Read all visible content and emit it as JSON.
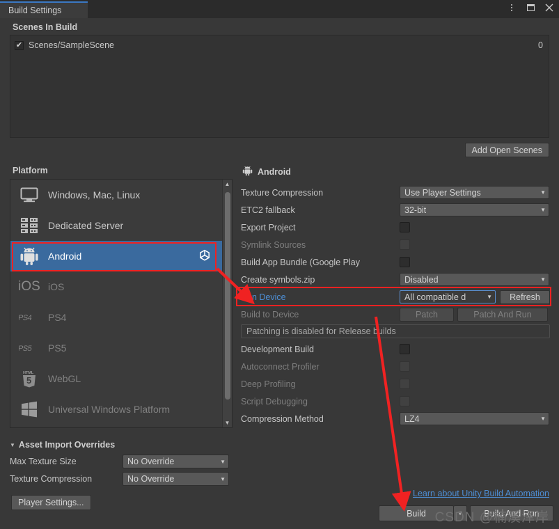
{
  "window": {
    "tab_label": "Build Settings",
    "controls": {
      "kebab": "kebab-menu-icon",
      "maximize": "maximize-icon",
      "close": "✕"
    }
  },
  "scenes": {
    "header": "Scenes In Build",
    "items": [
      {
        "name": "Scenes/SampleScene",
        "checked": true,
        "index": "0"
      }
    ],
    "add_open_scenes_label": "Add Open Scenes"
  },
  "platform": {
    "label": "Platform",
    "items": [
      {
        "label": "Windows, Mac, Linux",
        "icon": "monitor-icon",
        "state": "normal"
      },
      {
        "label": "Dedicated Server",
        "icon": "server-icon",
        "state": "normal"
      },
      {
        "label": "Android",
        "icon": "android-icon",
        "state": "selected",
        "badge": "unity-logo-icon"
      },
      {
        "label": "iOS",
        "icon": "ios-icon",
        "state": "disabled"
      },
      {
        "label": "PS4",
        "icon": "ps4-icon",
        "state": "disabled"
      },
      {
        "label": "PS5",
        "icon": "ps5-icon",
        "state": "disabled"
      },
      {
        "label": "WebGL",
        "icon": "html5-icon",
        "state": "disabled"
      },
      {
        "label": "Universal Windows Platform",
        "icon": "windows-icon",
        "state": "disabled"
      }
    ]
  },
  "target": {
    "title": "Android",
    "icon": "android-icon",
    "settings": [
      {
        "label": "Texture Compression",
        "type": "popup",
        "value": "Use Player Settings",
        "disabled": false
      },
      {
        "label": "ETC2 fallback",
        "type": "popup",
        "value": "32-bit",
        "disabled": false
      },
      {
        "label": "Export Project",
        "type": "checkbox",
        "value": false,
        "disabled": false
      },
      {
        "label": "Symlink Sources",
        "type": "checkbox",
        "value": false,
        "disabled": true
      },
      {
        "label": "Build App Bundle (Google Play",
        "type": "checkbox",
        "value": false,
        "disabled": false
      },
      {
        "label": "Create symbols.zip",
        "type": "popup",
        "value": "Disabled",
        "disabled": false
      }
    ],
    "run_device": {
      "label": "Run Device",
      "value": "All compatible d",
      "refresh_label": "Refresh",
      "highlighted": true
    },
    "build_to_device": {
      "label": "Build to Device",
      "patch_label": "Patch",
      "patch_and_run_label": "Patch And Run",
      "disabled": true
    },
    "patch_notice": "Patching is disabled for Release builds",
    "settings_lower": [
      {
        "label": "Development Build",
        "type": "checkbox",
        "value": false,
        "disabled": false
      },
      {
        "label": "Autoconnect Profiler",
        "type": "checkbox",
        "value": false,
        "disabled": true
      },
      {
        "label": "Deep Profiling",
        "type": "checkbox",
        "value": false,
        "disabled": true
      },
      {
        "label": "Script Debugging",
        "type": "checkbox",
        "value": false,
        "disabled": true
      },
      {
        "label": "Compression Method",
        "type": "popup",
        "value": "LZ4",
        "disabled": false
      }
    ]
  },
  "asset_import_overrides": {
    "header": "Asset Import Overrides",
    "rows": [
      {
        "label": "Max Texture Size",
        "value": "No Override"
      },
      {
        "label": "Texture Compression",
        "value": "No Override"
      }
    ],
    "player_settings_label": "Player Settings..."
  },
  "footer": {
    "learn_link": "Learn about Unity Build Automation",
    "build_label": "Build",
    "build_dropdown": "▼",
    "build_and_run_label": "Build And Run",
    "watermark": "CSDN @楠溪泽岸"
  },
  "colors": {
    "background": "#383838",
    "panel": "#3b3b3b",
    "selection_blue": "#3a6a9e",
    "annotation_red": "#f02222",
    "link_blue": "#4e8fd6",
    "focus_blue": "#5b8fd0"
  }
}
